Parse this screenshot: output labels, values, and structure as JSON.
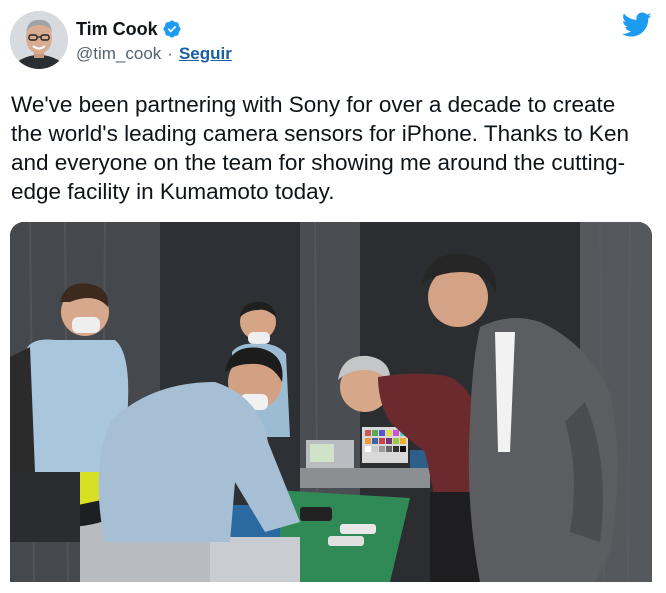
{
  "author": {
    "display_name": "Tim Cook",
    "handle": "@tim_cook",
    "separator": "·",
    "follow_label": "Seguir",
    "verified": true
  },
  "tweet": {
    "text": "We've been partnering with Sony for over a decade to create the world's leading camera sensors for iPhone. Thanks to Ken and everyone on the team for showing me around the cutting-edge facility in Kumamoto today."
  },
  "icons": {
    "verified": "verified-badge-icon",
    "brand": "twitter-bird-icon"
  },
  "colors": {
    "brand_blue": "#1d9bf0",
    "link_blue": "#1b5ea8",
    "text": "#0f1419",
    "secondary_text": "#536471"
  }
}
